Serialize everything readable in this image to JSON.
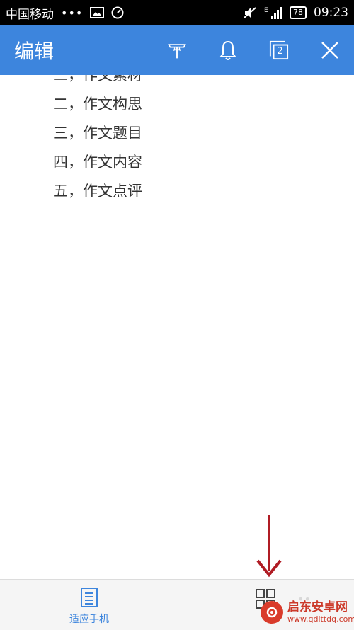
{
  "status_bar": {
    "carrier": "中国移动",
    "dots": "•••",
    "network_type": "E",
    "battery": "78",
    "time": "09:23"
  },
  "app_bar": {
    "title": "编辑",
    "tab_count": "2",
    "background_color": "#3d85dd"
  },
  "document": {
    "lines": [
      "二，作文素材",
      "二，作文构思",
      "三，作文题目",
      "四，作文内容",
      "五，作文点评"
    ]
  },
  "bottom_bar": {
    "fit_phone_label": "适应手机",
    "more_label": "••"
  },
  "watermark": {
    "name": "启东安卓网",
    "url": "www.qdlttdq.com",
    "color": "#cc3a2a"
  },
  "annotation": {
    "color": "#b01c24"
  }
}
